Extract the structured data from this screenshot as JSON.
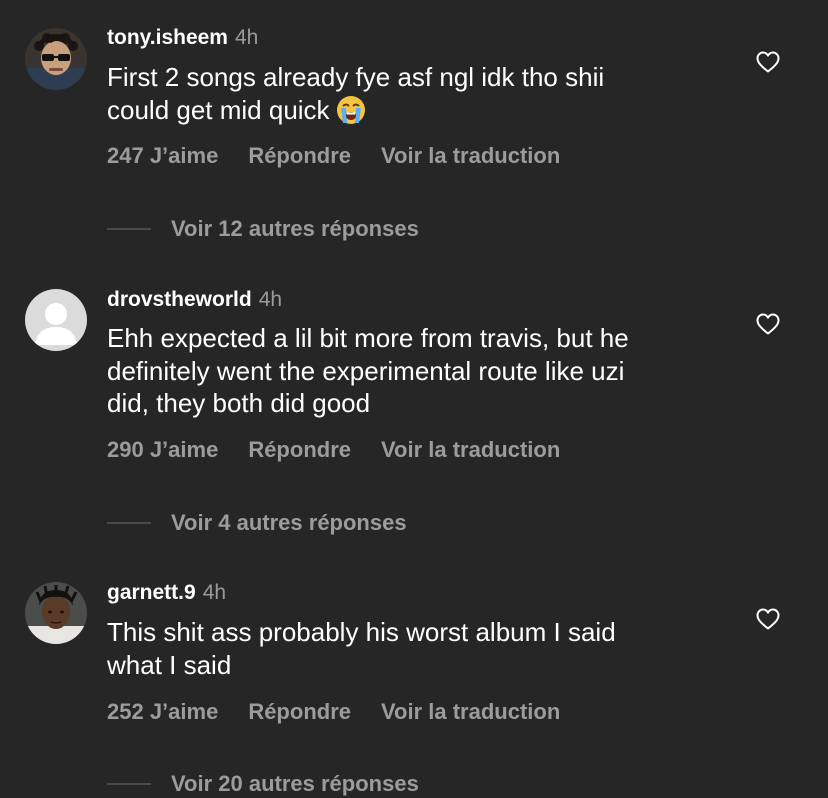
{
  "comments": [
    {
      "username": "tony.isheem",
      "time": "4h",
      "text_lines": [
        "First 2 songs already fye asf ngl idk tho shii",
        "could get mid quick"
      ],
      "emoji": "loudly-crying-face",
      "likes": "247 J’aime",
      "reply": "Répondre",
      "translate": "Voir la traduction",
      "more_replies": "Voir 12 autres réponses",
      "avatar": "profile-photo"
    },
    {
      "username": "drovstheworld",
      "time": "4h",
      "text_lines": [
        "Ehh expected a lil bit more from travis, but he",
        "definitely went the experimental route like uzi",
        "did, they both did good"
      ],
      "likes": "290 J’aime",
      "reply": "Répondre",
      "translate": "Voir la traduction",
      "more_replies": "Voir 4 autres réponses",
      "avatar": "default-avatar"
    },
    {
      "username": "garnett.9",
      "time": "4h",
      "text_lines": [
        "This shit ass probably his worst album I said",
        "what I said"
      ],
      "likes": "252 J’aime",
      "reply": "Répondre",
      "translate": "Voir la traduction",
      "more_replies": "Voir 20 autres réponses",
      "avatar": "profile-photo"
    }
  ],
  "colors": {
    "background": "#262626",
    "primary_text": "#ffffff",
    "secondary_text": "#9c9c9c",
    "divider": "#4a4a4a"
  },
  "icons": {
    "like": "heart-outline-icon"
  }
}
